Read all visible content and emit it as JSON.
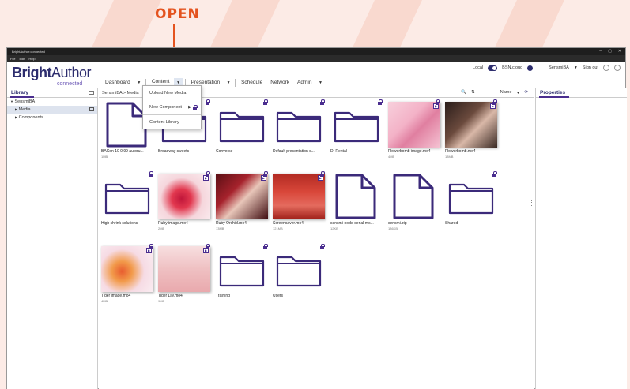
{
  "callout": {
    "label": "OPEN"
  },
  "window": {
    "title": "BrightAuthor:connected",
    "menu": [
      "File",
      "Edit",
      "Help"
    ]
  },
  "logo": {
    "brand": "Bright",
    "brand2": "Author",
    "sub": "connected"
  },
  "nav": {
    "items": [
      "Dashboard",
      "Content",
      "Presentation",
      "Schedule",
      "Network",
      "Admin"
    ],
    "active": "Content"
  },
  "topbar": {
    "local": "Local",
    "bsn": "BSN.cloud",
    "user": "SensmiBA",
    "signout": "Sign out"
  },
  "library": {
    "title": "Library",
    "tree": [
      {
        "label": "SensmiBA",
        "caret": "▼"
      },
      {
        "label": "Media",
        "caret": "▶"
      },
      {
        "label": "Components",
        "caret": "▶"
      }
    ]
  },
  "breadcrumb": {
    "text": "SensmiBA > Media",
    "sort": "Name"
  },
  "properties": {
    "title": "Properties"
  },
  "dropdown": {
    "items": [
      "Upload New Media",
      "New Component",
      "Content Library"
    ]
  },
  "colors": {
    "accent": "#4a2d8f",
    "callout": "#e4531f",
    "navy": "#2d2d6e"
  },
  "media": [
    {
      "name": "BACon 10 0 99 autoru...",
      "size": "1MB",
      "kind": "file"
    },
    {
      "name": "Broadway sweets",
      "size": "",
      "kind": "folder"
    },
    {
      "name": "Converse",
      "size": "",
      "kind": "folder"
    },
    {
      "name": "Default presentation c...",
      "size": "",
      "kind": "folder"
    },
    {
      "name": "DI Rental",
      "size": "",
      "kind": "folder"
    },
    {
      "name": "Flowerbomb image.mo4",
      "size": "4MB",
      "kind": "video"
    },
    {
      "name": "Flowerbomb.mo4",
      "size": "13MB",
      "kind": "video"
    },
    {
      "name": "High shrink solutions",
      "size": "",
      "kind": "folder"
    },
    {
      "name": "Ruby image.mo4",
      "size": "2MB",
      "kind": "video"
    },
    {
      "name": "Ruby Orchid.mo4",
      "size": "13MB",
      "kind": "video"
    },
    {
      "name": "Screensaver.mo4",
      "size": "121MB",
      "kind": "video"
    },
    {
      "name": "sensmi-node-serial-ms...",
      "size": "12KB",
      "kind": "file"
    },
    {
      "name": "sensmi.zip",
      "size": "136KB",
      "kind": "file"
    },
    {
      "name": "Shared",
      "size": "",
      "kind": "folder"
    },
    {
      "name": "Tiger image.mo4",
      "size": "4MB",
      "kind": "video"
    },
    {
      "name": "Tiger Lily.mo4",
      "size": "9MB",
      "kind": "video"
    },
    {
      "name": "Training",
      "size": "",
      "kind": "folder"
    },
    {
      "name": "Users",
      "size": "",
      "kind": "folder"
    }
  ]
}
